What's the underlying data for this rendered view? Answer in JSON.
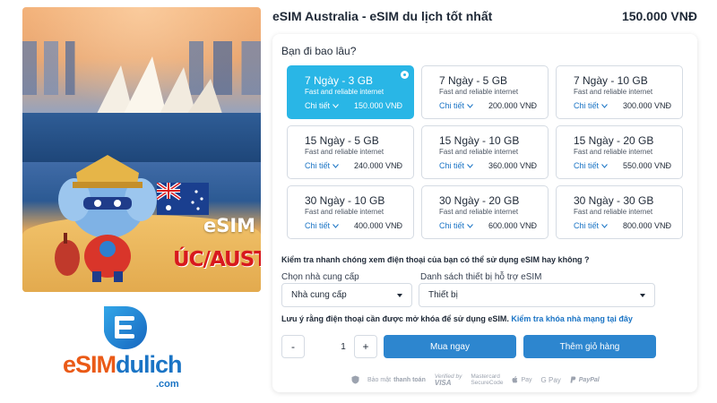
{
  "product": {
    "title": "eSIM Australia - eSIM du lịch tốt nhất",
    "price": "150.000 VNĐ"
  },
  "hero": {
    "tag": "eSIM",
    "country": "ÚC/AUSTRALIA"
  },
  "logo": {
    "part1": "eSIM",
    "part2": "dulich",
    "suffix": ".com"
  },
  "duration_question": "Bạn đi bao lâu?",
  "plans": [
    {
      "plan": "7 Ngày - 3 GB",
      "desc": "Fast and reliable internet",
      "detail": "Chi tiết",
      "price": "150.000 VNĐ",
      "selected": true
    },
    {
      "plan": "7 Ngày - 5 GB",
      "desc": "Fast and reliable internet",
      "detail": "Chi tiết",
      "price": "200.000 VNĐ",
      "selected": false
    },
    {
      "plan": "7 Ngày - 10 GB",
      "desc": "Fast and reliable internet",
      "detail": "Chi tiết",
      "price": "300.000 VNĐ",
      "selected": false
    },
    {
      "plan": "15 Ngày - 5 GB",
      "desc": "Fast and reliable internet",
      "detail": "Chi tiết",
      "price": "240.000 VNĐ",
      "selected": false
    },
    {
      "plan": "15 Ngày - 10 GB",
      "desc": "Fast and reliable internet",
      "detail": "Chi tiết",
      "price": "360.000 VNĐ",
      "selected": false
    },
    {
      "plan": "15 Ngày - 20 GB",
      "desc": "Fast and reliable internet",
      "detail": "Chi tiết",
      "price": "550.000 VNĐ",
      "selected": false
    },
    {
      "plan": "30 Ngày - 10 GB",
      "desc": "Fast and reliable internet",
      "detail": "Chi tiết",
      "price": "400.000 VNĐ",
      "selected": false
    },
    {
      "plan": "30 Ngày - 20 GB",
      "desc": "Fast and reliable internet",
      "detail": "Chi tiết",
      "price": "600.000 VNĐ",
      "selected": false
    },
    {
      "plan": "30 Ngày - 30 GB",
      "desc": "Fast and reliable internet",
      "detail": "Chi tiết",
      "price": "800.000 VNĐ",
      "selected": false
    }
  ],
  "compat": {
    "question": "Kiểm tra nhanh chóng xem điện thoại của bạn có thể sử dụng eSIM hay không ?",
    "provider_label": "Chọn nhà cung cấp",
    "provider_value": "Nhà cung cấp",
    "device_label": "Danh sách thiết bị hỗ trợ eSIM",
    "device_value": "Thiết bị"
  },
  "unlock": {
    "text": "Lưu ý rằng điện thoại cần được mở khóa để sử dụng eSIM.",
    "link": "Kiểm tra khóa nhà mạng tại đây"
  },
  "quantity": {
    "minus": "-",
    "value": "1",
    "plus": "+"
  },
  "actions": {
    "buy": "Mua ngay",
    "cart": "Thêm giỏ hàng"
  },
  "payments": {
    "secure_prefix": "Bảo mật",
    "secure_strong": "thanh toán",
    "visa_top": "Verified by",
    "visa_bottom": "VISA",
    "mc_top": "Mastercard",
    "mc_bottom": "SecureCode",
    "apple": "Pay",
    "google": "G Pay",
    "paypal": "PayPal"
  },
  "colors": {
    "selected": "#29b6e6",
    "primary_button": "#2d86cf",
    "link": "#1a74c5",
    "logo_orange": "#ea5a17",
    "logo_blue": "#1a74c5",
    "country_red": "#d8191e"
  }
}
